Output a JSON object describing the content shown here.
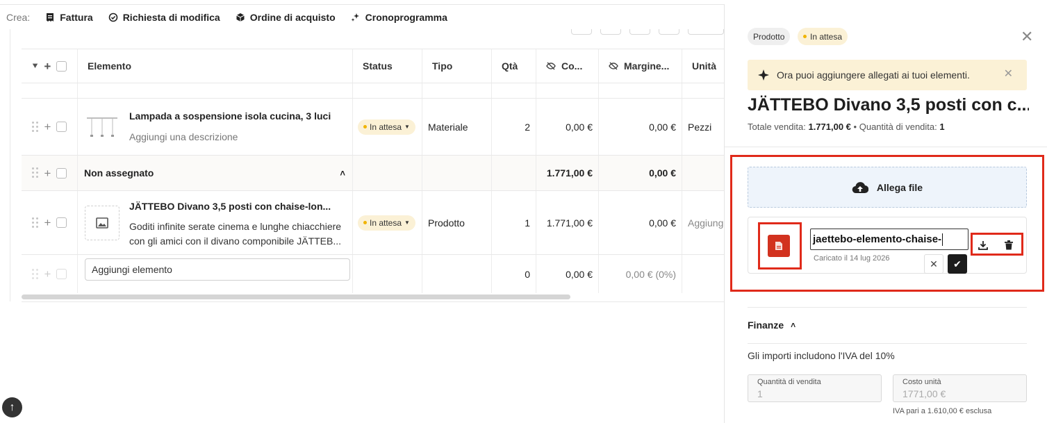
{
  "createbar": {
    "label": "Crea:",
    "items": [
      {
        "label": "Fattura",
        "icon": "invoice-icon"
      },
      {
        "label": "Richiesta di modifica",
        "icon": "change-request-icon"
      },
      {
        "label": "Ordine di acquisto",
        "icon": "purchase-order-icon"
      },
      {
        "label": "Cronoprogramma",
        "icon": "schedule-icon"
      }
    ]
  },
  "table": {
    "headers": {
      "elemento": "Elemento",
      "status": "Status",
      "tipo": "Tipo",
      "qta": "Qtà",
      "costo": "Co...",
      "margine": "Margine...",
      "unita": "Unità"
    },
    "rows": [
      {
        "name": "Lampada a sospensione isola cucina, 3 luci",
        "description": "Aggiungi una descrizione",
        "status": "In attesa",
        "tipo": "Materiale",
        "qta": "2",
        "costo": "0,00 €",
        "margine": "0,00 €",
        "unita": "Pezzi"
      },
      {
        "name": "JÄTTEBO Divano 3,5 posti con chaise-lon...",
        "description_line1": "Goditi infinite serate cinema e lunghe chiacchiere",
        "description_line2": "con gli amici con il divano componibile JÄTTEB...",
        "status": "In attesa",
        "tipo": "Prodotto",
        "qta": "1",
        "costo": "1.771,00 €",
        "margine": "0,00 €",
        "unita": "Aggiung"
      }
    ],
    "group": {
      "name": "Non assegnato",
      "costo": "1.771,00 €",
      "margine": "0,00 €"
    },
    "add_row": {
      "placeholder": "Aggiungi elemento",
      "qta": "0",
      "costo": "0,00 €",
      "margine": "0,00 € (0%)"
    }
  },
  "panel": {
    "tags": {
      "type": "Prodotto",
      "status": "In attesa"
    },
    "notice": "Ora puoi aggiungere allegati ai tuoi elementi.",
    "title": "JÄTTEBO Divano 3,5 posti con c...",
    "subtitle": {
      "total_label": "Totale vendita:",
      "total_value": "1.771,00 €",
      "separator": "•",
      "qty_label": "Quantità di vendita:",
      "qty_value": "1"
    },
    "upload_label": "Allega file",
    "file": {
      "name_value": "jaettebo-elemento-chaise-",
      "uploaded": "Caricato il 14 lug 2026"
    },
    "finanze": {
      "title": "Finanze",
      "vat_note": "Gli importi includono l'IVA del 10%",
      "qty_label": "Quantità di vendita",
      "qty_value": "1",
      "unit_cost_label": "Costo unità",
      "unit_cost_value": "1771,00 €",
      "unit_cost_note": "IVA pari a 1.610,00 € esclusa"
    }
  },
  "colors": {
    "accent_red": "#e02a1a",
    "status_yellow": "#f0b400",
    "pill_bg": "#fbf1d6"
  }
}
